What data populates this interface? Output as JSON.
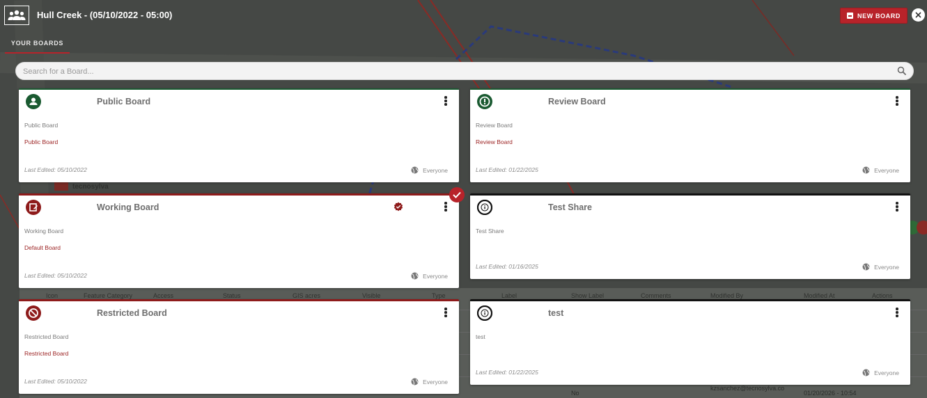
{
  "colors": {
    "accent": "#b8232a",
    "dark_red": "#8e1b1b",
    "green": "#1a5a31"
  },
  "header": {
    "title": "Hull Creek - (05/10/2022 - 05:00)",
    "new_board_label": "NEW BOARD",
    "icon": "group-icon"
  },
  "tabs": [
    {
      "label": "YOUR BOARDS",
      "active": true
    }
  ],
  "search": {
    "placeholder": "Search for a Board...",
    "value": ""
  },
  "boards": [
    {
      "title": "Public Board",
      "description": "Public Board",
      "subtitle": "Public Board",
      "last_edited": "Last Edited: 05/10/2022",
      "share": "Everyone",
      "icon": "person-icon"
    },
    {
      "title": "Review Board",
      "description": "Review Board",
      "subtitle": "Review Board",
      "last_edited": "Last Edited: 01/22/2025",
      "share": "Everyone",
      "icon": "review-icon"
    },
    {
      "title": "Working Board",
      "description": "Working Board",
      "subtitle": "Default Board",
      "last_edited": "Last Edited: 05/10/2022",
      "share": "Everyone",
      "icon": "edit-note-icon",
      "selected": true
    },
    {
      "title": "Test Share",
      "description": "Test Share",
      "subtitle": "",
      "last_edited": "Last Edited: 01/16/2025",
      "share": "Everyone",
      "icon": "info-icon"
    },
    {
      "title": "Restricted Board",
      "description": "Restricted Board",
      "subtitle": "Restricted Board",
      "last_edited": "Last Edited: 05/10/2022",
      "share": "Everyone",
      "icon": "block-icon"
    },
    {
      "title": "test",
      "description": "test",
      "subtitle": "",
      "last_edited": "Last Edited: 01/22/2025",
      "share": "Everyone",
      "icon": "info-icon"
    }
  ],
  "background_table": {
    "columns": [
      "Icon",
      "Feature Category",
      "Access",
      "Status",
      "GIS acres",
      "Visible",
      "Type",
      "Label",
      "Show Label",
      "Comments",
      "Modified By",
      "Modified At",
      "Actions"
    ],
    "row": {
      "visible": "No",
      "modified_by": "kzsanchez@tecnosylva.co",
      "modified_at": "01/20/2026 - 10:54"
    },
    "map_label": "tecnosylva"
  }
}
